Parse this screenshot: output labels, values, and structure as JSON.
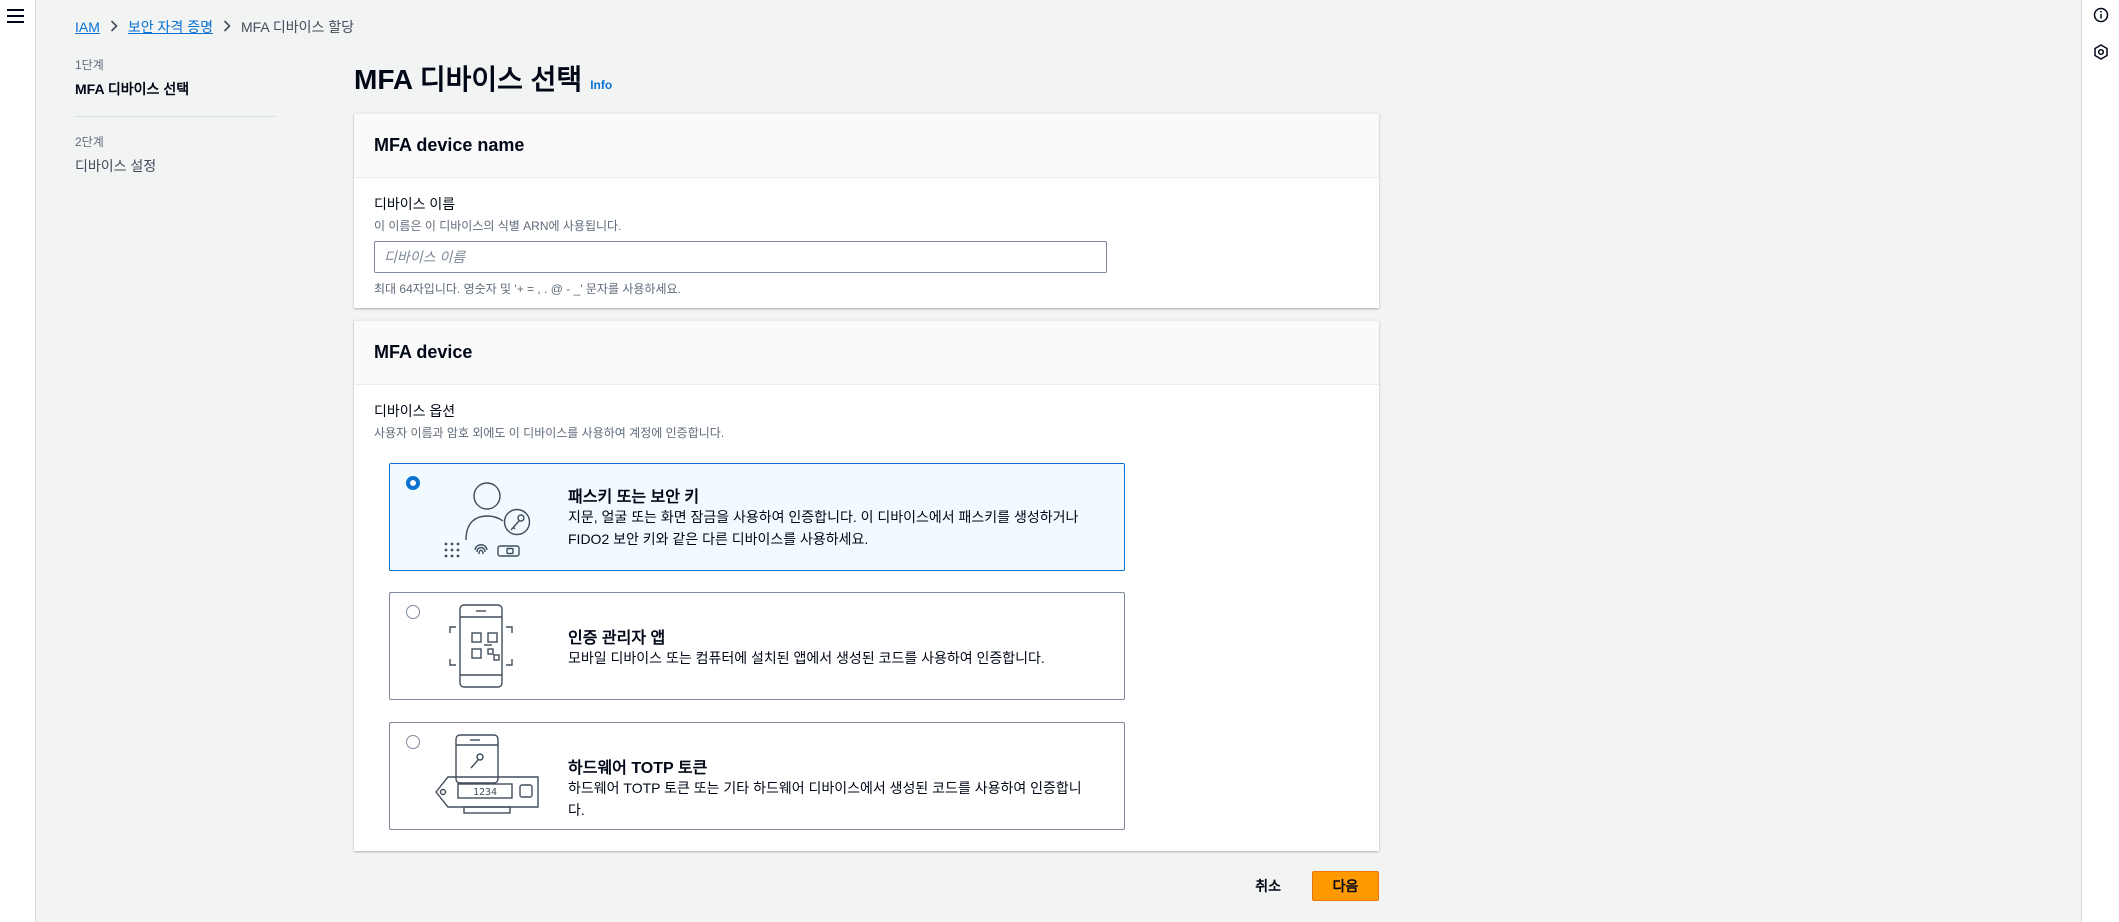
{
  "breadcrumb": {
    "items": [
      "IAM",
      "보안 자격 증명"
    ],
    "current": "MFA 디바이스 할당"
  },
  "steps": [
    {
      "number": "1단계",
      "name": "MFA 디바이스 선택"
    },
    {
      "number": "2단계",
      "name": "디바이스 설정"
    }
  ],
  "page": {
    "title": "MFA 디바이스 선택",
    "info_label": "Info"
  },
  "device_name_panel": {
    "header": "MFA device name",
    "field_label": "디바이스 이름",
    "field_description": "이 이름은 이 디바이스의 식별 ARN에 사용됩니다.",
    "placeholder": "디바이스 이름",
    "value": "",
    "constraint": "최대 64자입니다. 영숫자 및 '+ = , . @ - _' 문자를 사용하세요."
  },
  "device_panel": {
    "header": "MFA device",
    "field_label": "디바이스 옵션",
    "field_description": "사용자 이름과 암호 외에도 이 디바이스를 사용하여 계정에 인증합니다.",
    "options": [
      {
        "title": "패스키 또는 보안 키",
        "description": "지문, 얼굴 또는 화면 잠금을 사용하여 인증합니다. 이 디바이스에서 패스키를 생성하거나 FIDO2 보안 키와 같은 다른 디바이스를 사용하세요.",
        "selected": true,
        "icon": "passkey-illustration-icon"
      },
      {
        "title": "인증 관리자 앱",
        "description": "모바일 디바이스 또는 컴퓨터에 설치된 앱에서 생성된 코드를 사용하여 인증합니다.",
        "selected": false,
        "icon": "authenticator-app-illustration-icon"
      },
      {
        "title": "하드웨어 TOTP 토큰",
        "description": "하드웨어 TOTP 토큰 또는 기타 하드웨어 디바이스에서 생성된 코드를 사용하여 인증합니다.",
        "selected": false,
        "icon": "hardware-token-illustration-icon",
        "token_display": "1234"
      }
    ]
  },
  "actions": {
    "cancel_label": "취소",
    "next_label": "다음"
  },
  "colors": {
    "link": "#0972d3",
    "primary_button": "#ff9900",
    "selected_bg": "#f1faff"
  }
}
